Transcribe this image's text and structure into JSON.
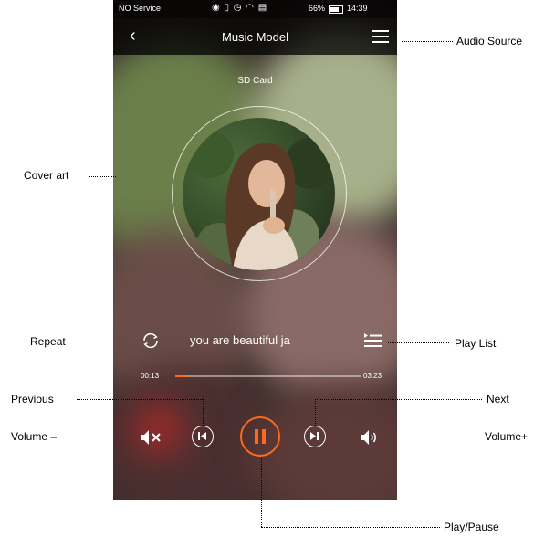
{
  "status_bar": {
    "carrier": "NO Service",
    "battery": "66%",
    "time": "14:39"
  },
  "header": {
    "title": "Music Model"
  },
  "source_label": "SD Card",
  "player": {
    "song_title": "you are beautiful ja",
    "elapsed": "00:13",
    "duration": "03:23",
    "progress_fraction": 0.064
  },
  "callouts": {
    "audio_source": "Audio Source",
    "cover_art": "Cover art",
    "repeat": "Repeat",
    "play_list": "Play List",
    "previous": "Previous",
    "next": "Next",
    "volume_minus": "Volume –",
    "volume_plus": "Volume+",
    "play_pause": "Play/Pause"
  },
  "colors": {
    "accent": "#ff6a1a",
    "status_bar": "#000000"
  },
  "icons": [
    "back-icon",
    "menu-icon",
    "repeat-icon",
    "playlist-icon",
    "mute-icon",
    "previous-icon",
    "pause-icon",
    "next-icon",
    "volume-icon"
  ]
}
